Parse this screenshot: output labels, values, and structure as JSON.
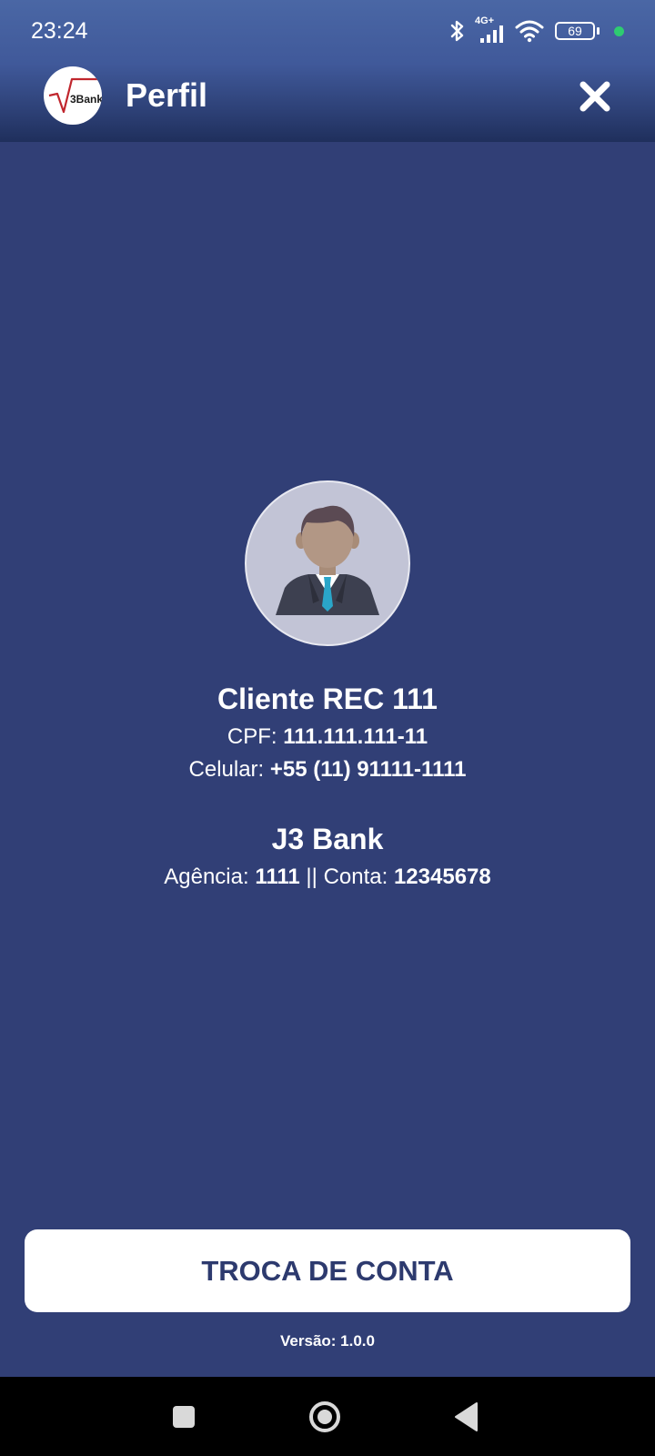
{
  "status_bar": {
    "time": "23:24",
    "network": "4G+",
    "battery": "69",
    "icons": [
      "bluetooth-icon",
      "signal-icon",
      "wifi-icon",
      "battery-icon"
    ]
  },
  "header": {
    "logo_text": "3Bank",
    "title": "Perfil",
    "close_icon": "close-icon"
  },
  "profile": {
    "avatar_icon": "user-avatar-icon",
    "name": "Cliente REC 111",
    "cpf_label": "CPF:",
    "cpf_value": "111.111.111-11",
    "phone_label": "Celular:",
    "phone_value": "+55 (11) 91111-1111"
  },
  "bank": {
    "name": "J3 Bank",
    "agency_label": "Agência:",
    "agency_value": "1111",
    "separator": "||",
    "account_label": "Conta:",
    "account_value": "12345678"
  },
  "actions": {
    "switch_account_label": "TROCA DE CONTA"
  },
  "footer": {
    "version": "Versão: 1.0.0"
  },
  "nav": {
    "icons": [
      "recent-apps-icon",
      "home-icon",
      "back-icon"
    ]
  },
  "colors": {
    "background": "#313f76",
    "header": "#40599a",
    "button_bg": "#ffffff",
    "button_text": "#2d3a6e",
    "status_dot": "#2ecc71"
  }
}
